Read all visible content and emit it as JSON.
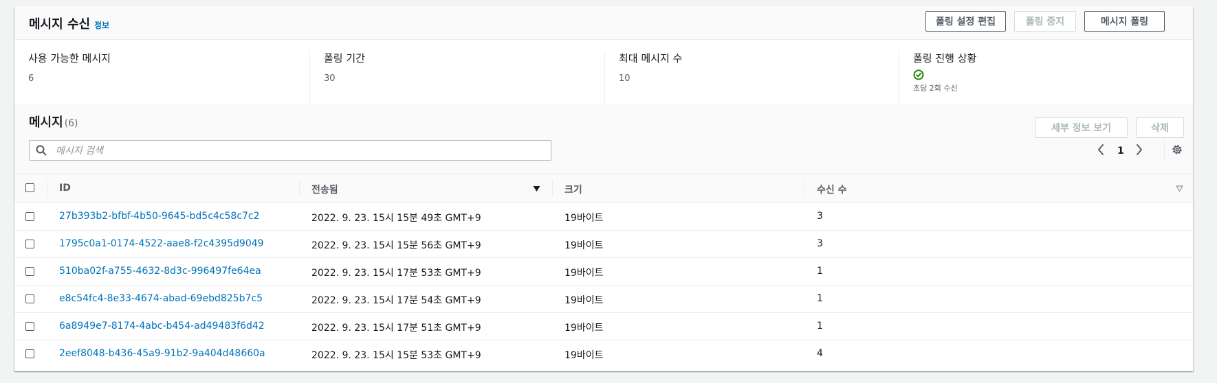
{
  "receive": {
    "title": "메시지 수신",
    "info": "정보",
    "buttons": {
      "edit": "폴링 설정 편집",
      "stop": "폴링 중지",
      "poll": "메시지 폴링"
    }
  },
  "stats": {
    "available": {
      "label": "사용 가능한 메시지",
      "value": "6"
    },
    "duration": {
      "label": "폴링 기간",
      "value": "30"
    },
    "max": {
      "label": "최대 메시지 수",
      "value": "10"
    },
    "progress": {
      "label": "폴링 진행 상황",
      "icon": "check-circle-icon",
      "sub": "초당 2회 수신"
    }
  },
  "messages": {
    "title": "메시지",
    "count": "(6)",
    "buttons": {
      "details": "세부 정보 보기",
      "delete": "삭제"
    },
    "search_placeholder": "메시지 검색",
    "page": "1"
  },
  "table": {
    "headers": {
      "id": "ID",
      "sent": "전송됨",
      "size": "크기",
      "receive_count": "수신 수"
    },
    "rows": [
      {
        "id": "27b393b2-bfbf-4b50-9645-bd5c4c58c7c2",
        "sent": "2022. 9. 23. 15시 15분 49초 GMT+9",
        "size": "19바이트",
        "count": "3"
      },
      {
        "id": "1795c0a1-0174-4522-aae8-f2c4395d9049",
        "sent": "2022. 9. 23. 15시 15분 56초 GMT+9",
        "size": "19바이트",
        "count": "3"
      },
      {
        "id": "510ba02f-a755-4632-8d3c-996497fe64ea",
        "sent": "2022. 9. 23. 15시 17분 53초 GMT+9",
        "size": "19바이트",
        "count": "1"
      },
      {
        "id": "e8c54fc4-8e33-4674-abad-69ebd825b7c5",
        "sent": "2022. 9. 23. 15시 17분 54초 GMT+9",
        "size": "19바이트",
        "count": "1"
      },
      {
        "id": "6a8949e7-8174-4abc-b454-ad49483f6d42",
        "sent": "2022. 9. 23. 15시 17분 51초 GMT+9",
        "size": "19바이트",
        "count": "1"
      },
      {
        "id": "2eef8048-b436-45a9-91b2-9a404d48660a",
        "sent": "2022. 9. 23. 15시 15분 53초 GMT+9",
        "size": "19바이트",
        "count": "4"
      }
    ]
  },
  "colors": {
    "link": "#0073bb",
    "success": "#1d8102",
    "border": "#eaeded"
  }
}
